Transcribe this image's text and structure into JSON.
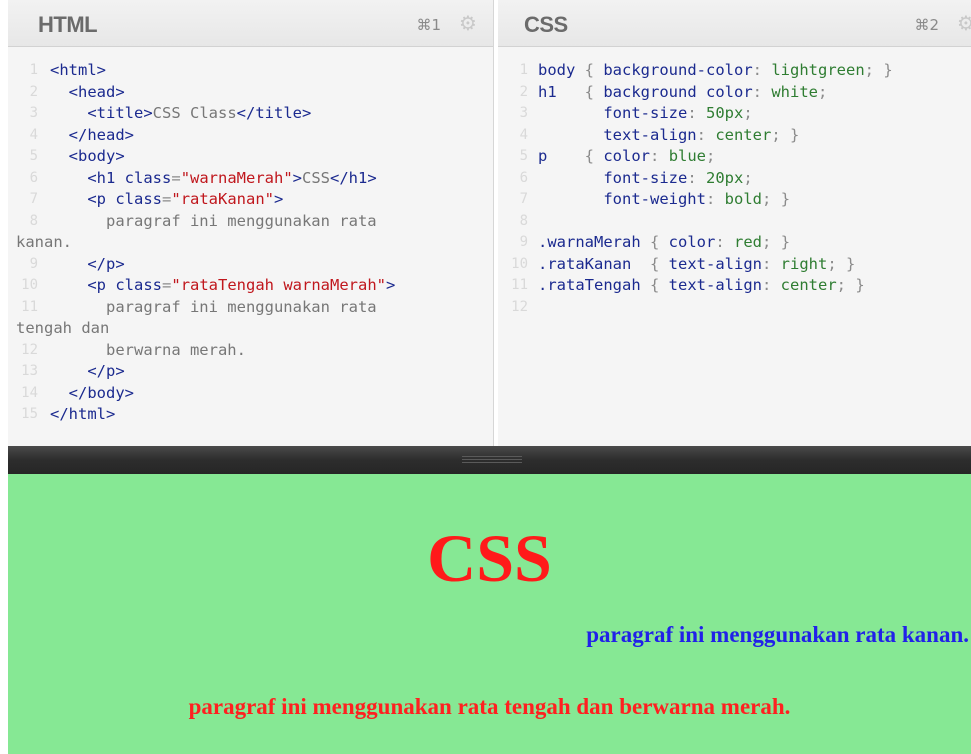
{
  "html_pane": {
    "title": "HTML",
    "shortcut": "⌘1",
    "lines": [
      {
        "n": "1",
        "t": "<html>"
      },
      {
        "n": "2",
        "t": "  <head>"
      },
      {
        "n": "3",
        "t": "    <title>CSS Class</title>"
      },
      {
        "n": "4",
        "t": "  </head>"
      },
      {
        "n": "5",
        "t": "  <body>"
      },
      {
        "n": "6",
        "t": "    <h1 class=\"warnaMerah\">CSS</h1>"
      },
      {
        "n": "7",
        "t": "    <p class=\"rataKanan\">"
      },
      {
        "n": "8",
        "t": "      paragraf ini menggunakan rata"
      },
      {
        "n": "",
        "t": "kanan."
      },
      {
        "n": "9",
        "t": "    </p>"
      },
      {
        "n": "10",
        "t": "    <p class=\"rataTengah warnaMerah\">"
      },
      {
        "n": "11",
        "t": "      paragraf ini menggunakan rata"
      },
      {
        "n": "",
        "t": "tengah dan"
      },
      {
        "n": "12",
        "t": "      berwarna merah."
      },
      {
        "n": "13",
        "t": "    </p>"
      },
      {
        "n": "14",
        "t": "  </body>"
      },
      {
        "n": "15",
        "t": "</html>"
      }
    ]
  },
  "css_pane": {
    "title": "CSS",
    "shortcut": "⌘2",
    "lines": [
      {
        "n": "1",
        "t": "body { background-color: lightgreen; }"
      },
      {
        "n": "2",
        "t": "h1   { background color: white;"
      },
      {
        "n": "3",
        "t": "       font-size: 50px;"
      },
      {
        "n": "4",
        "t": "       text-align: center; }"
      },
      {
        "n": "5",
        "t": "p    { color: blue;"
      },
      {
        "n": "6",
        "t": "       font-size: 20px;"
      },
      {
        "n": "7",
        "t": "       font-weight: bold; }"
      },
      {
        "n": "8",
        "t": ""
      },
      {
        "n": "9",
        "t": ".warnaMerah { color: red; }"
      },
      {
        "n": "10",
        "t": ".rataKanan  { text-align: right; }"
      },
      {
        "n": "11",
        "t": ".rataTengah { text-align: center; }"
      },
      {
        "n": "12",
        "t": ""
      }
    ]
  },
  "preview": {
    "h1": "CSS",
    "p_right": "paragraf ini menggunakan rata kanan.",
    "p_center": "paragraf ini menggunakan rata tengah dan berwarna merah.",
    "background": "#86e894",
    "red": "#ff1a1a",
    "blue": "#2121e8"
  },
  "icons": {
    "settings": "gear-icon",
    "splitter": "grip-icon"
  }
}
